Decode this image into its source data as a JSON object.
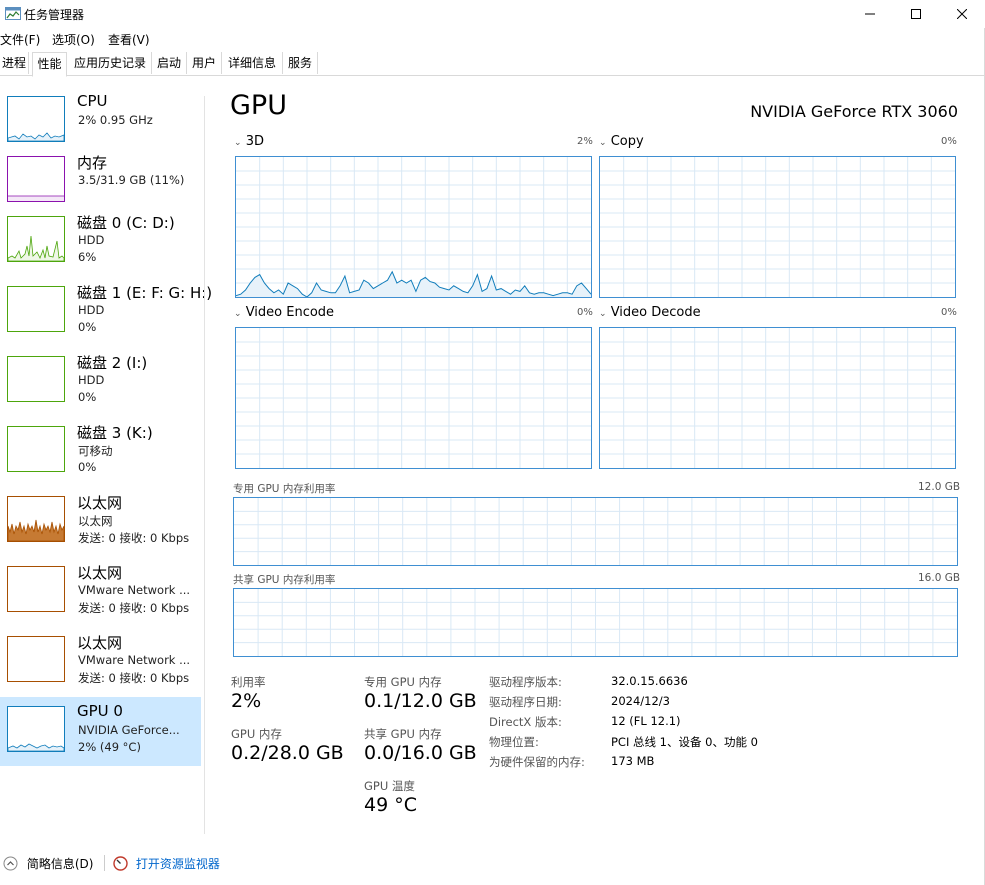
{
  "window": {
    "title": "任务管理器"
  },
  "menu": [
    "文件(F)",
    "选项(O)",
    "查看(V)"
  ],
  "tabs": [
    {
      "label": "进程",
      "active": false
    },
    {
      "label": "性能",
      "active": true
    },
    {
      "label": "应用历史记录",
      "active": false
    },
    {
      "label": "启动",
      "active": false
    },
    {
      "label": "用户",
      "active": false
    },
    {
      "label": "详细信息",
      "active": false
    },
    {
      "label": "服务",
      "active": false
    }
  ],
  "sidebar": {
    "items": [
      {
        "name": "CPU",
        "line1": "2% 0.95 GHz",
        "line2": "",
        "color": "#117dbb",
        "fill": "#e7f2fa",
        "selected": false
      },
      {
        "name": "内存",
        "line1": "3.5/31.9 GB (11%)",
        "line2": "",
        "color": "#8b12ae",
        "fill": "#f4e8f7",
        "selected": false
      },
      {
        "name": "磁盘 0 (C: D:)",
        "line1": "HDD",
        "line2": "6%",
        "color": "#4da60c",
        "fill": "#eff7e7",
        "selected": false
      },
      {
        "name": "磁盘 1 (E: F: G: H:)",
        "line1": "HDD",
        "line2": "0%",
        "color": "#4da60c",
        "fill": "#eff7e7",
        "selected": false
      },
      {
        "name": "磁盘 2 (I:)",
        "line1": "HDD",
        "line2": "0%",
        "color": "#4da60c",
        "fill": "#eff7e7",
        "selected": false
      },
      {
        "name": "磁盘 3 (K:)",
        "line1": "可移动",
        "line2": "0%",
        "color": "#4da60c",
        "fill": "#eff7e7",
        "selected": false
      },
      {
        "name": "以太网",
        "line1": "以太网",
        "line2": "发送: 0 接收: 0 Kbps",
        "color": "#a74f01",
        "fill": "#f7ede4",
        "selected": false
      },
      {
        "name": "以太网",
        "line1": "VMware Network ...",
        "line2": "发送: 0 接收: 0 Kbps",
        "color": "#a74f01",
        "fill": "#f7ede4",
        "selected": false
      },
      {
        "name": "以太网",
        "line1": "VMware Network ...",
        "line2": "发送: 0 接收: 0 Kbps",
        "color": "#a74f01",
        "fill": "#f7ede4",
        "selected": false
      },
      {
        "name": "GPU 0",
        "line1": "NVIDIA GeForce...",
        "line2": "2% (49 °C)",
        "color": "#117dbb",
        "fill": "#e7f2fa",
        "selected": true
      }
    ]
  },
  "main": {
    "title": "GPU",
    "model": "NVIDIA GeForce RTX 3060",
    "graphs": [
      {
        "label": "3D",
        "pct": "2%"
      },
      {
        "label": "Copy",
        "pct": "0%"
      },
      {
        "label": "Video Encode",
        "pct": "0%"
      },
      {
        "label": "Video Decode",
        "pct": "0%"
      }
    ],
    "dedicated_mem": {
      "label": "专用 GPU 内存利用率",
      "max": "12.0 GB"
    },
    "shared_mem": {
      "label": "共享 GPU 内存利用率",
      "max": "16.0 GB"
    },
    "stats": {
      "util_label": "利用率",
      "util_value": "2%",
      "gpumem_label": "GPU 内存",
      "gpumem_value": "0.2/28.0 GB",
      "dedicated_label": "专用 GPU 内存",
      "dedicated_value": "0.1/12.0 GB",
      "shared_label": "共享 GPU 内存",
      "shared_value": "0.0/16.0 GB",
      "temp_label": "GPU 温度",
      "temp_value": "49 °C"
    },
    "info": [
      {
        "key": "驱动程序版本:",
        "value": "32.0.15.6636"
      },
      {
        "key": "驱动程序日期:",
        "value": "2024/12/3"
      },
      {
        "key": "DirectX 版本:",
        "value": "12 (FL 12.1)"
      },
      {
        "key": "物理位置:",
        "value": "PCI 总线 1、设备 0、功能 0"
      },
      {
        "key": "为硬件保留的内存:",
        "value": "173 MB"
      }
    ],
    "util_3d_history": [
      1,
      2,
      5,
      10,
      14,
      16,
      10,
      6,
      3,
      5,
      2,
      10,
      8,
      6,
      2,
      0,
      3,
      10,
      5,
      4,
      3,
      3,
      8,
      15,
      3,
      4,
      5,
      12,
      10,
      6,
      8,
      10,
      12,
      18,
      10,
      12,
      10,
      12,
      4,
      12,
      14,
      11,
      10,
      7,
      6,
      5,
      8,
      6,
      4,
      3,
      8,
      16,
      4,
      6,
      15,
      5,
      6,
      4,
      2,
      5,
      4,
      8,
      3,
      2,
      3,
      3,
      2,
      1,
      2,
      3,
      3,
      2,
      8,
      10,
      6,
      2
    ]
  },
  "footer": {
    "summary": "简略信息(D)",
    "open_monitor": "打开资源监视器"
  },
  "colors": {
    "accent": "#117dbb",
    "graph_border": "#3f8fd2",
    "grid": "#d9e8f5",
    "selected": "#cce8ff"
  }
}
